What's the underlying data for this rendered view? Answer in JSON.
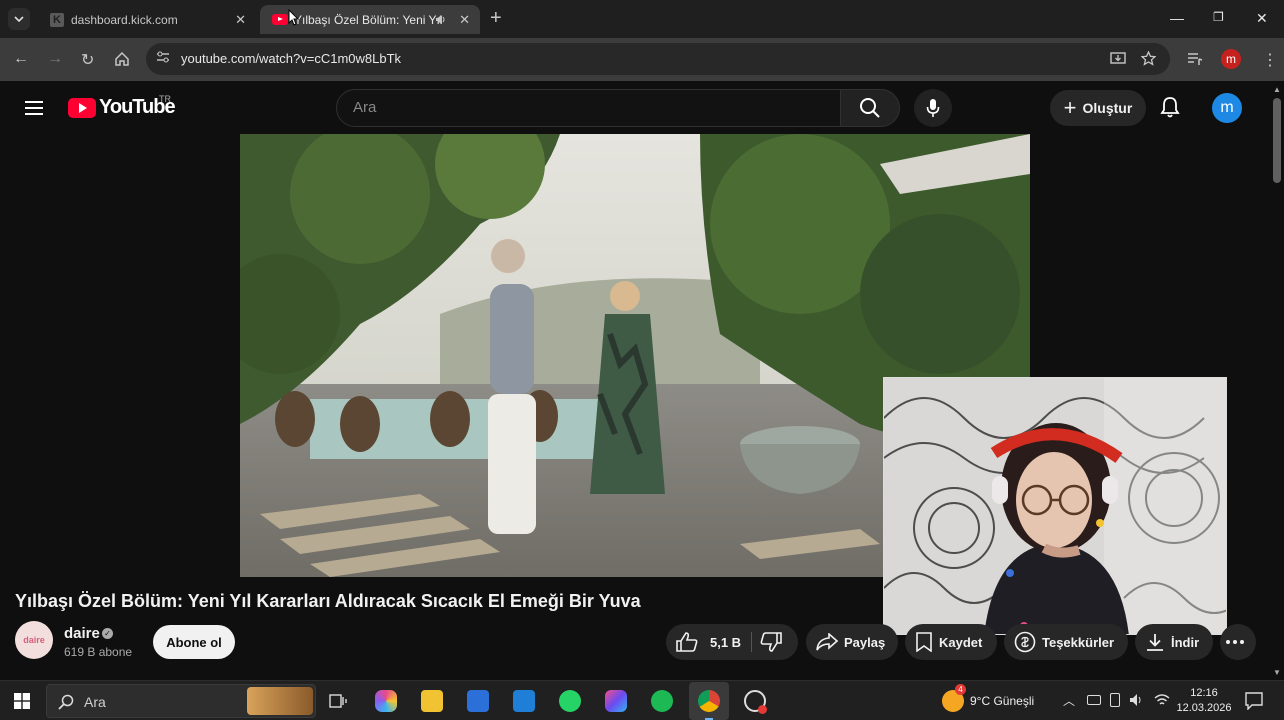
{
  "browser": {
    "tabs": [
      {
        "title": "dashboard.kick.com",
        "active": false
      },
      {
        "title": "Yılbaşı Özel Bölüm: Yeni Yıl",
        "active": true
      }
    ],
    "url": "youtube.com/watch?v=cC1m0w8LbTk",
    "profile_initial": "m"
  },
  "youtube": {
    "logo_text": "YouTube",
    "country_code": "TR",
    "search_placeholder": "Ara",
    "create_label": "Oluştur",
    "avatar_initial": "m"
  },
  "video": {
    "title": "Yılbaşı Özel Bölüm: Yeni Yıl Kararları Aldıracak Sıcacık El Emeği Bir Yuva",
    "channel_name": "daire",
    "channel_avatar_text": "daire",
    "subscribers": "619 B abone",
    "subscribe_label": "Abone ol",
    "like_count": "5,1 B",
    "share_label": "Paylaş",
    "save_label": "Kaydet",
    "thanks_label": "Teşekkürler",
    "download_label": "İndir"
  },
  "taskbar": {
    "search_placeholder": "Ara",
    "weather": "9°C  Güneşli",
    "weather_badge": "4",
    "time": "12:16",
    "date": "12.03.2026"
  },
  "colors": {
    "yt_red": "#ff0033",
    "background": "#0f0f0f",
    "pill": "#272727",
    "avatar_blue": "#1e88e5"
  }
}
